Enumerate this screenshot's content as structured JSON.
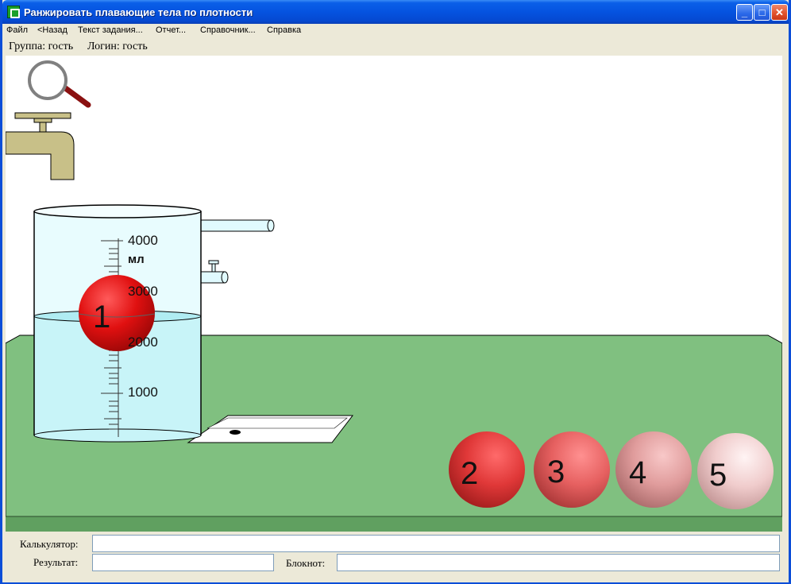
{
  "window": {
    "title": "Ранжировать плавающие тела по плотности",
    "minimize_glyph": "_",
    "maximize_glyph": "□",
    "close_glyph": "✕"
  },
  "menu": {
    "items": [
      "Файл",
      "<Назад",
      "Текст задания...",
      "Отчет...",
      "Справочник...",
      "Справка"
    ]
  },
  "info": {
    "group": "Группа: гость",
    "login": "Логин: гость"
  },
  "scene": {
    "icons": [
      "magnifier-icon",
      "faucet-icon"
    ],
    "beaker": {
      "unit": "мл",
      "scale_labels": [
        "4000",
        "3000",
        "2000",
        "1000"
      ]
    },
    "balls": [
      {
        "label": "1",
        "color": "#e01010"
      },
      {
        "label": "2",
        "color": "#e83a3a"
      },
      {
        "label": "3",
        "color": "#ec6464"
      },
      {
        "label": "4",
        "color": "#e0a0a0"
      },
      {
        "label": "5",
        "color": "#f0d0d0"
      }
    ],
    "colors": {
      "table_top": "#80c080",
      "table_edge": "#60a060",
      "water": "#c8f4f8",
      "beaker_glass": "#e8fcfe",
      "faucet": "#c8c088"
    }
  },
  "bottom": {
    "calculator_label": "Калькулятор:",
    "calculator_value": "",
    "result_label": "Результат:",
    "result_value": "",
    "notepad_label": "Блокнот:",
    "notepad_value": ""
  }
}
